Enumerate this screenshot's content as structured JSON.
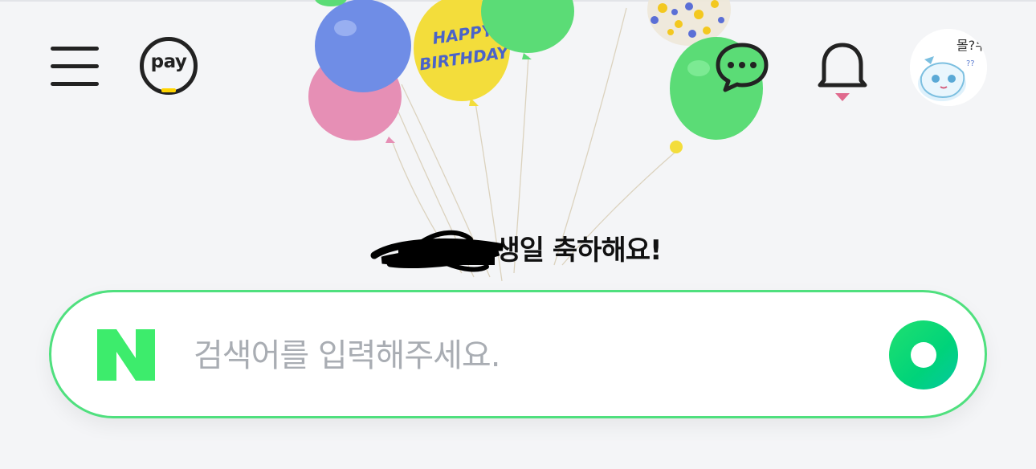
{
  "header": {
    "menu_icon": "hamburger-menu-icon",
    "pay_label": "pay",
    "talk_icon": "chat-bubble-icon",
    "bell_icon": "notification-bell-icon",
    "avatar_icon": "profile-avatar"
  },
  "balloons": {
    "birthday_text_line1": "HAPPY",
    "birthday_text_line2": "BIRTHDAY"
  },
  "greeting": {
    "message": "생일 축하해요!"
  },
  "search": {
    "placeholder": "검색어를 입력해주세요.",
    "logo_letter": "N",
    "submit_icon": "greendot-icon"
  },
  "colors": {
    "accent_green": "#4fe07e",
    "logo_green": "#3dec6c",
    "pay_yellow": "#ffd400"
  }
}
